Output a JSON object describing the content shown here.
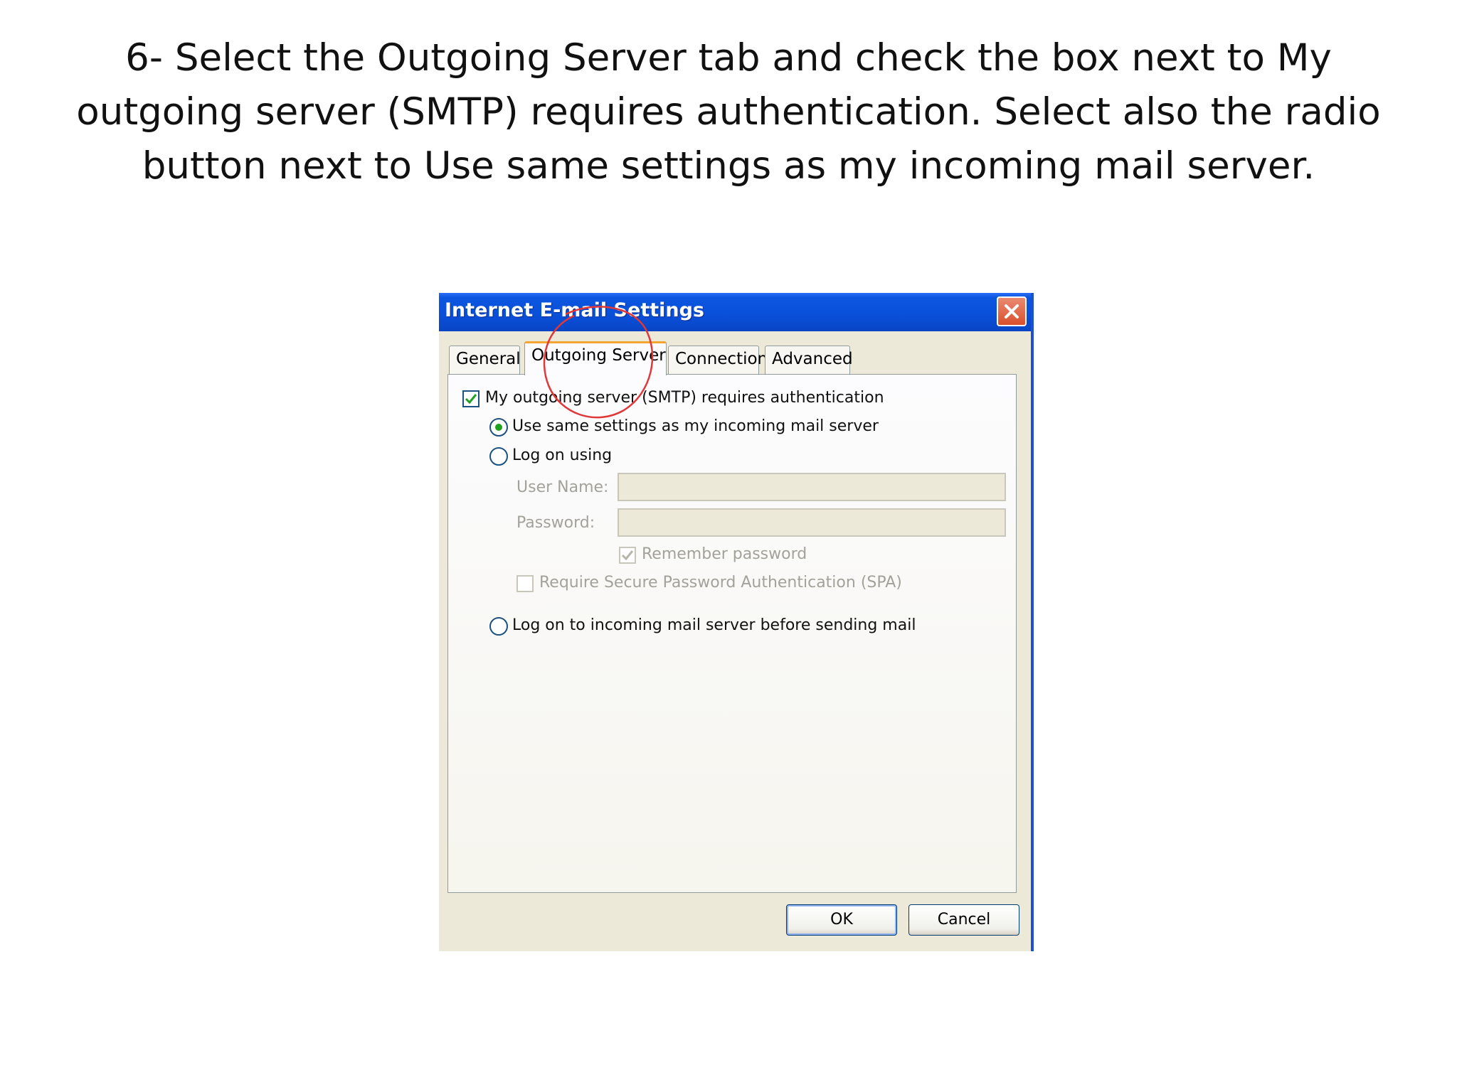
{
  "instruction": {
    "line1": "6- Select the Outgoing Server tab and check the box next to My",
    "line2": "outgoing server (SMTP) requires authentication. Select also the radio",
    "line3": "button next to Use same settings as my incoming mail server."
  },
  "dialog": {
    "title": "Internet E-mail Settings",
    "tabs": [
      {
        "label": "General"
      },
      {
        "label": "Outgoing Server"
      },
      {
        "label": "Connection"
      },
      {
        "label": "Advanced"
      }
    ],
    "active_tab": "Outgoing Server",
    "smtp_auth": {
      "label": "My outgoing server (SMTP) requires authentication",
      "checked": true
    },
    "use_same": {
      "label": "Use same settings as my incoming mail server",
      "selected": true
    },
    "log_on_using": {
      "label": "Log on using",
      "selected": false
    },
    "user_name": {
      "label": "User Name:",
      "value": ""
    },
    "password": {
      "label": "Password:",
      "value": ""
    },
    "remember_password": {
      "label": "Remember password",
      "checked": true,
      "enabled": false
    },
    "spa": {
      "label": "Require Secure Password Authentication (SPA)",
      "checked": false,
      "enabled": false
    },
    "log_on_incoming": {
      "label": "Log on to incoming mail server before sending mail",
      "selected": false
    },
    "ok_label": "OK",
    "cancel_label": "Cancel"
  },
  "colors": {
    "titlebar": "#0a4fd8",
    "dialog_bg": "#ece9d8",
    "active_tab_accent": "#f3a533",
    "check_green": "#21a121",
    "annotation": "#e03838"
  },
  "icons": {
    "close": "close-icon",
    "check": "checkmark-icon"
  }
}
